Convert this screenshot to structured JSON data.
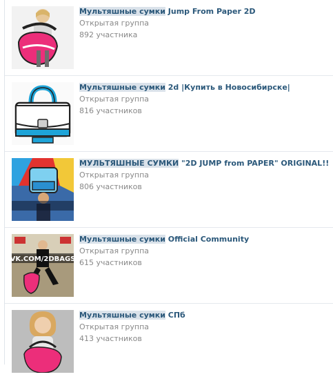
{
  "groups": [
    {
      "title_highlight": "Мультяшные сумки",
      "title_rest": " Jump From Paper 2D",
      "type": "Открытая группа",
      "members": "892 участника"
    },
    {
      "title_highlight": "Мультяшные сумки",
      "title_rest": " 2d |Купить в Новосибирске|",
      "type": "Открытая группа",
      "members": "816 участников"
    },
    {
      "title_highlight": "МУЛЬТЯШНЫЕ СУМКИ",
      "title_rest": " \"2D JUMP from PAPER\" ORIGINAL!!",
      "type": "Открытая группа",
      "members": "806 участников"
    },
    {
      "title_highlight": "Мультяшные сумки",
      "title_rest": " Official Community",
      "type": "Открытая группа",
      "members": "615 участников",
      "thumb_text": "VK.COM/2DBAGS"
    },
    {
      "title_highlight": "Мультяшные сумки",
      "title_rest": " СПб",
      "type": "Открытая группа",
      "members": "413 участников"
    }
  ],
  "colors": {
    "link": "#2b587a",
    "muted": "#888888",
    "highlight": "#dae2ea",
    "divider": "#e4e8ed"
  }
}
